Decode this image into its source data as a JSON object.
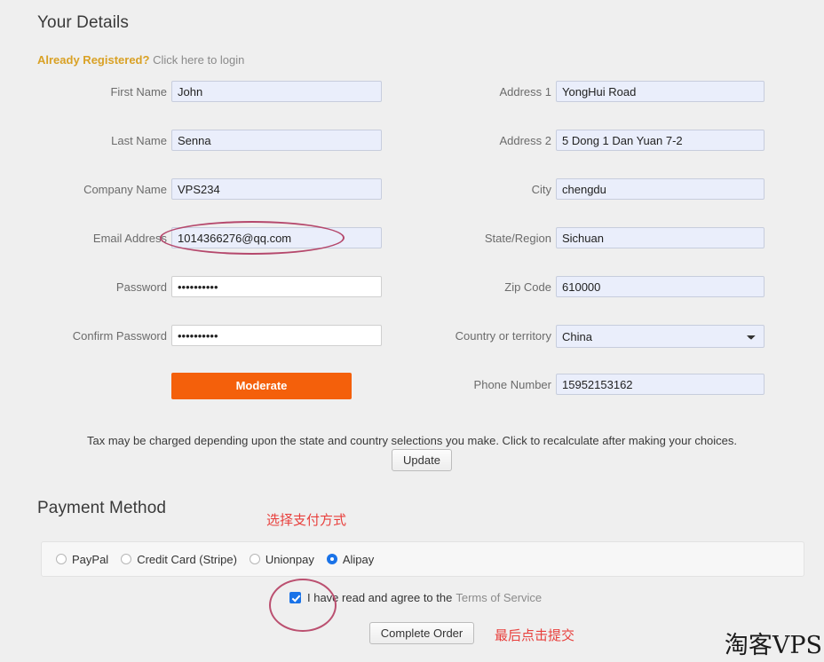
{
  "sections": {
    "your_details_title": "Your Details",
    "payment_method_title": "Payment Method"
  },
  "login_prompt": {
    "bold_text": "Already Registered?",
    "link_text": "Click here to login"
  },
  "left_fields": [
    {
      "label": "First Name",
      "value": "John",
      "type": "text"
    },
    {
      "label": "Last Name",
      "value": "Senna",
      "type": "text"
    },
    {
      "label": "Company Name",
      "value": "VPS234",
      "type": "text"
    },
    {
      "label": "Email Address",
      "value": "1014366276@qq.com",
      "type": "text"
    },
    {
      "label": "Password",
      "value": "••••••••••",
      "type": "password"
    },
    {
      "label": "Confirm Password",
      "value": "••••••••••",
      "type": "password"
    }
  ],
  "right_fields": [
    {
      "label": "Address 1",
      "value": "YongHui Road",
      "type": "text"
    },
    {
      "label": "Address 2",
      "value": "5 Dong 1 Dan Yuan 7-2",
      "type": "text"
    },
    {
      "label": "City",
      "value": "chengdu",
      "type": "text"
    },
    {
      "label": "State/Region",
      "value": "Sichuan",
      "type": "text"
    },
    {
      "label": "Zip Code",
      "value": "610000",
      "type": "text"
    },
    {
      "label": "Country or territory",
      "value": "China",
      "type": "select"
    },
    {
      "label": "Phone Number",
      "value": "15952153162",
      "type": "text"
    }
  ],
  "moderate_button_label": "Moderate",
  "tax_note": "Tax may be charged depending upon the state and country selections you make. Click to recalculate after making your choices.",
  "update_button_label": "Update",
  "payment_options": [
    {
      "label": "PayPal",
      "selected": false
    },
    {
      "label": "Credit Card (Stripe)",
      "selected": false
    },
    {
      "label": "Unionpay",
      "selected": false
    },
    {
      "label": "Alipay",
      "selected": true
    }
  ],
  "terms": {
    "text": "I have read and agree to the",
    "link_text": "Terms of Service",
    "checked": true
  },
  "complete_order_button_label": "Complete Order",
  "annotations": {
    "payment_note_cn": "选择支付方式",
    "submit_note_cn": "最后点击提交",
    "ellipse_target": "email-address-input",
    "circle_target": "terms-checkbox"
  },
  "watermark": "淘客VPS",
  "colors": {
    "accent_orange": "#f4600b",
    "annotation_red": "#e8403d",
    "annotation_ink": "#b8436a",
    "registered_amber": "#d9a125",
    "radio_blue": "#1a73e8",
    "input_bg": "#eaeefb"
  }
}
